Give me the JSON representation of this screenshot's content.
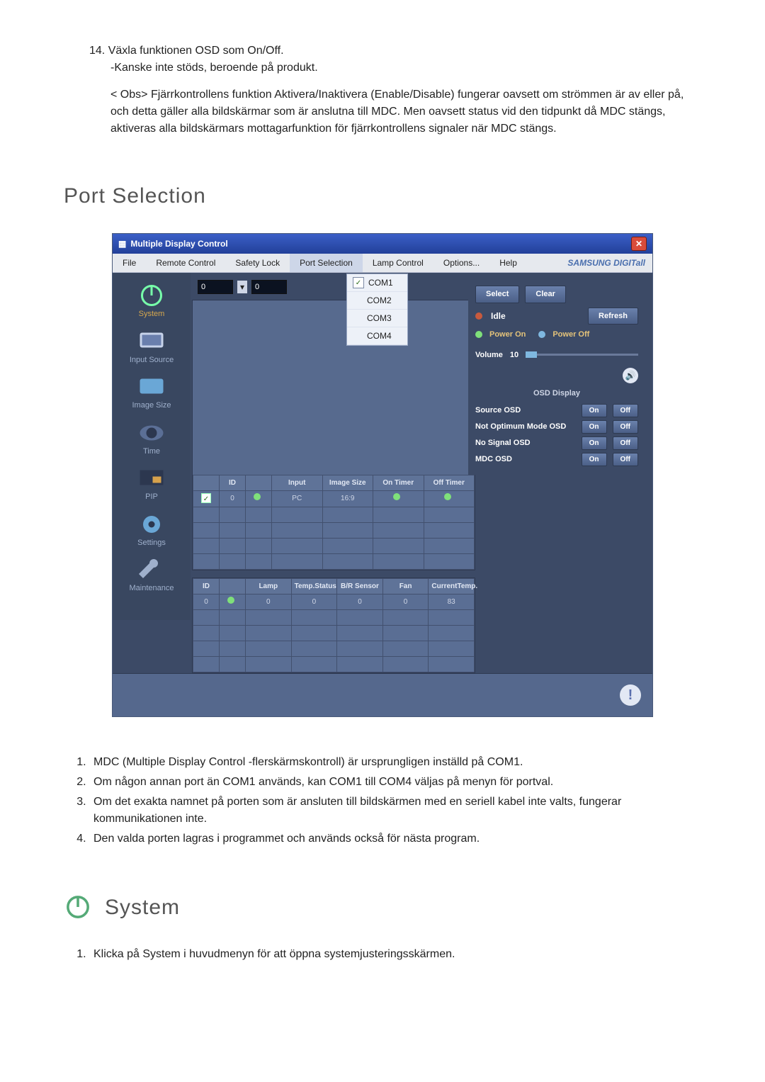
{
  "doc": {
    "item14_prefix": "14.",
    "item14_main": "Växla funktionen OSD som On/Off.",
    "item14_sub": "-Kanske inte stöds, beroende på produkt.",
    "note_label": "< Obs>",
    "note_text": "Fjärrkontrollens funktion Aktivera/Inaktivera (Enable/Disable) fungerar oavsett om strömmen är av eller på, och detta gäller alla bildskärmar som är anslutna till MDC. Men oavsett status vid den tidpunkt då MDC stängs, aktiveras alla bildskärmars mottagarfunktion för fjärrkontrollens signaler när MDC stängs.",
    "heading_port": "Port Selection",
    "list_port": [
      "MDC (Multiple Display Control -flerskärmskontroll) är ursprungligen inställd på COM1.",
      "Om någon annan port än COM1 används, kan COM1 till COM4 väljas på menyn för portval.",
      "Om det exakta namnet på porten som är ansluten till bildskärmen med en seriell kabel inte valts, fungerar kommunikationen inte.",
      "Den valda porten lagras i programmet och används också för nästa program."
    ],
    "heading_system": "System",
    "list_system": [
      "Klicka på System i huvudmenyn för att öppna systemjusteringsskärmen."
    ]
  },
  "app": {
    "title": "Multiple Display Control",
    "menus": [
      "File",
      "Remote Control",
      "Safety Lock",
      "Port Selection",
      "Lamp Control",
      "Options...",
      "Help"
    ],
    "brand": "SAMSUNG DIGITall",
    "ports": [
      "COM1",
      "COM2",
      "COM3",
      "COM4"
    ],
    "port_selected": "COM1",
    "btn_select": "Select",
    "btn_clear": "Clear",
    "status_label": "Idle",
    "btn_refresh": "Refresh",
    "id_from": "0",
    "id_to": "0",
    "power_on": "Power On",
    "power_off": "Power Off",
    "volume_label": "Volume",
    "volume_val": "10",
    "osd_title": "OSD Display",
    "osd_rows": [
      "Source OSD",
      "Not Optimum Mode OSD",
      "No Signal OSD",
      "MDC OSD"
    ],
    "on": "On",
    "off": "Off",
    "sidebar": [
      "System",
      "Input Source",
      "Image Size",
      "Time",
      "PIP",
      "Settings",
      "Maintenance"
    ],
    "table1_headers": [
      "",
      "ID",
      "",
      "Input",
      "Image Size",
      "On Timer",
      "Off Timer"
    ],
    "table1_row": [
      "",
      "0",
      "",
      "PC",
      "16:9",
      "",
      ""
    ],
    "table2_headers": [
      "ID",
      "",
      "Lamp",
      "Temp.Status",
      "B/R Sensor",
      "Fan",
      "CurrentTemp."
    ],
    "table2_row": [
      "0",
      "",
      "0",
      "0",
      "0",
      "0",
      "83"
    ]
  }
}
